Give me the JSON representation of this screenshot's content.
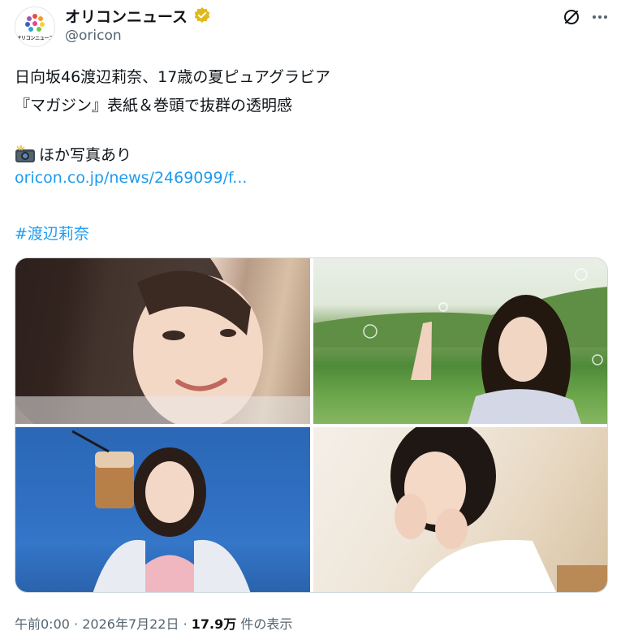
{
  "account": {
    "display_name": "オリコンニュース",
    "handle": "@oricon",
    "avatar_text": "オリコンニュース",
    "verified_color": "#e2b719"
  },
  "post": {
    "line1": "日向坂46渡辺莉奈、17歳の夏ピュアグラビア",
    "line2": "『マガジン』表紙＆巻頭で抜群の透明感",
    "line3": "ほか写真あり",
    "link": "oricon.co.jp/news/2469099/f...",
    "hashtag": "#渡辺莉奈"
  },
  "media": {
    "photos": [
      {
        "alt": "close-up smiling portrait"
      },
      {
        "alt": "pointing upward with bubbles on green hills"
      },
      {
        "alt": "holding iced drink on blue background"
      },
      {
        "alt": "resting chin on hands"
      }
    ]
  },
  "meta": {
    "time": "午前0:00",
    "separator": "·",
    "date": "2026年7月22日",
    "views": "17.9万",
    "views_label": "件の表示"
  },
  "colors": {
    "link": "#1d9bf0",
    "text": "#0f1419",
    "secondary": "#536471"
  }
}
